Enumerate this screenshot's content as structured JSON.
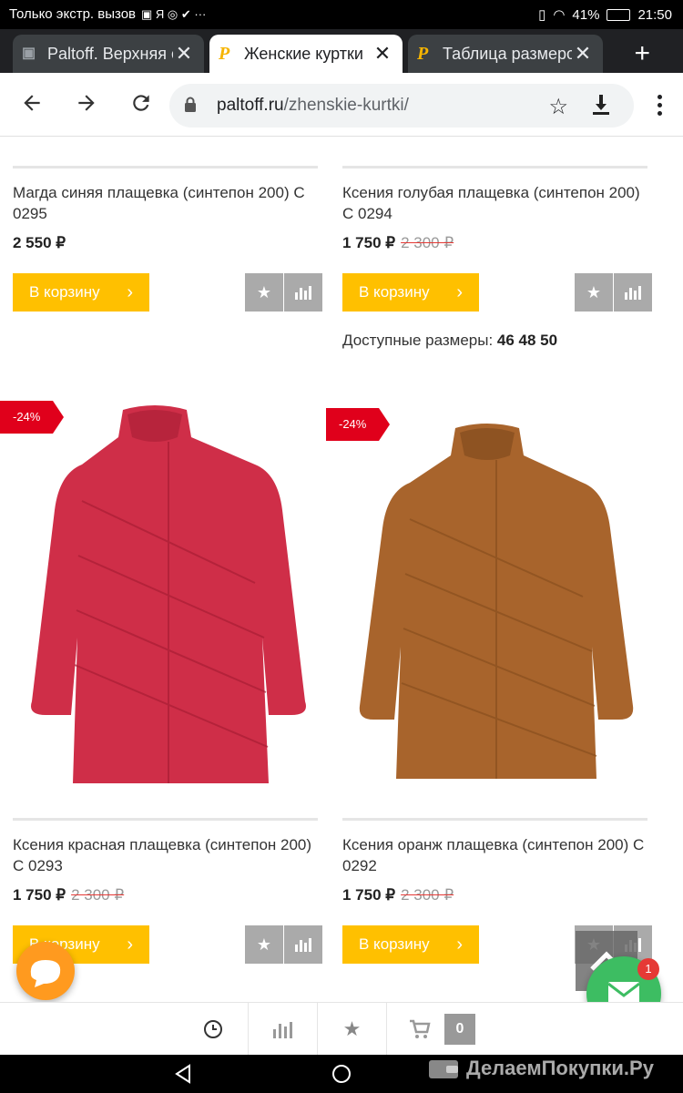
{
  "statusbar": {
    "left_text": "Только экстр. вызов",
    "battery": "41%",
    "time": "21:50"
  },
  "tabs": [
    {
      "title": "Paltoff. Верхняя о",
      "favicon": "wallet-icon",
      "active": false
    },
    {
      "title": "Женские куртки",
      "favicon": "P",
      "active": true
    },
    {
      "title": "Таблица размеро",
      "favicon": "P",
      "active": false
    }
  ],
  "toolbar": {
    "url_domain": "paltoff.ru",
    "url_path": "/zhenskie-kurtki/"
  },
  "products": [
    {
      "name": "Магда синяя плащевка (синтепон 200) С 0295",
      "price": "2 550 ₽",
      "old_price": "",
      "cart_label": "В корзину"
    },
    {
      "name": "Ксения голубая плащевка (синтепон 200) С 0294",
      "price": "1 750 ₽",
      "old_price": "2 300 ₽",
      "cart_label": "В корзину",
      "sizes_label": "Доступные размеры:",
      "sizes": "46 48 50"
    },
    {
      "name": "Ксения красная плащевка (синтепон 200) С 0293",
      "price": "1 750 ₽",
      "old_price": "2 300 ₽",
      "cart_label": "В корзину",
      "discount": "-24%",
      "color": "#cf2e48"
    },
    {
      "name": "Ксения оранж плащевка (синтепон 200) С 0292",
      "price": "1 750 ₽",
      "old_price": "2 300 ₽",
      "cart_label": "В корзину",
      "discount": "-24%",
      "color": "#a8642c"
    }
  ],
  "bottombar": {
    "cart_count": "0"
  },
  "mail_fab": {
    "notification_count": "1"
  },
  "watermark": {
    "text": "ДелаемПокупки.Ру"
  }
}
